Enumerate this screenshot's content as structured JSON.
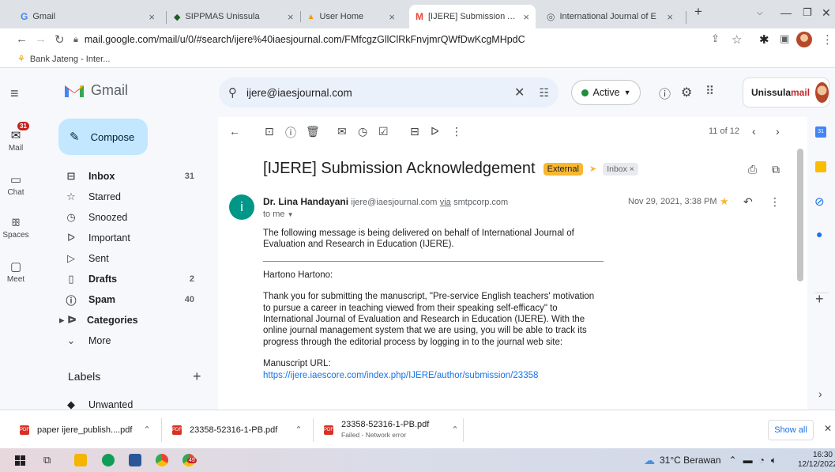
{
  "browser": {
    "tabs": [
      {
        "title": "Gmail",
        "icon": "gmail-g-icon"
      },
      {
        "title": "SIPPMAS Unissula",
        "icon": "sippmas-icon"
      },
      {
        "title": "User Home",
        "icon": "user-home-icon"
      },
      {
        "title": "[IJERE] Submission Ackno",
        "icon": "gmail-icon",
        "active": true
      },
      {
        "title": "International Journal of E",
        "icon": "globe-icon"
      }
    ],
    "new_tab": "+",
    "url": "mail.google.com/mail/u/0/#search/ijere%40iaesjournal.com/FMfcgzGllClRkFnvjmrQWfDwKcgMHpdC",
    "bookmark": "Bank Jateng - Inter..."
  },
  "gmail": {
    "brand": "Gmail",
    "search_value": "ijere@iaesjournal.com",
    "status": "Active",
    "account_label_prefix": "Unissula",
    "account_label_suffix": "mail",
    "rail": {
      "mail_badge": "31",
      "items": [
        "Mail",
        "Chat",
        "Spaces",
        "Meet"
      ]
    },
    "compose_label": "Compose",
    "nav": [
      {
        "label": "Inbox",
        "count": "31",
        "bold": true,
        "icon": "inbox-icon"
      },
      {
        "label": "Starred",
        "count": "",
        "bold": false,
        "icon": "star-icon"
      },
      {
        "label": "Snoozed",
        "count": "",
        "bold": false,
        "icon": "clock-icon"
      },
      {
        "label": "Important",
        "count": "",
        "bold": false,
        "icon": "important-icon"
      },
      {
        "label": "Sent",
        "count": "",
        "bold": false,
        "icon": "send-icon"
      },
      {
        "label": "Drafts",
        "count": "2",
        "bold": true,
        "icon": "draft-icon"
      },
      {
        "label": "Spam",
        "count": "40",
        "bold": true,
        "icon": "spam-icon"
      },
      {
        "label": "Categories",
        "count": "",
        "bold": true,
        "icon": "label-icon"
      },
      {
        "label": "More",
        "count": "",
        "bold": false,
        "icon": "chevron-down-icon"
      }
    ],
    "labels_heading": "Labels",
    "labels": [
      "Unwanted"
    ],
    "pagination": "11 of 12",
    "message": {
      "subject": "[IJERE] Submission Acknowledgement",
      "label_external": "External",
      "label_inbox": "Inbox",
      "sender_name": "Dr. Lina Handayani",
      "sender_email": "ijere@iaesjournal.com",
      "via_label": "via",
      "via_domain": "smtpcorp.com",
      "to": "to me",
      "date": "Nov 29, 2021, 3:38 PM",
      "avatar_letter": "i",
      "intro": "The following message is being delivered on behalf of International Journal of Evaluation and Research in Education (IJERE).",
      "greeting": "Hartono Hartono:",
      "body": "Thank you for submitting the manuscript, \"Pre-service English teachers' motivation to pursue a career in teaching viewed from their speaking self-efficacy\" to International Journal of Evaluation and Research in Education (IJERE). With the online journal management system that we are using, you will be able to track its progress through the editorial process by logging in to the journal web site:",
      "url_label": "Manuscript URL:",
      "url": "https://ijere.iaescore.com/index.php/IJERE/author/submission/23358"
    }
  },
  "downloads": {
    "items": [
      {
        "name": "paper ijere_publish....pdf",
        "status": ""
      },
      {
        "name": "23358-52316-1-PB.pdf",
        "status": ""
      },
      {
        "name": "23358-52316-1-PB.pdf",
        "status": "Failed - Network error"
      }
    ],
    "show_all": "Show all"
  },
  "taskbar": {
    "weather": "31°C Berawan",
    "time": "16:30",
    "date": "12/12/2022",
    "chrome_badge": "49"
  },
  "colors": {
    "gmail_bg": "#f6f8fc",
    "compose": "#c2e7ff",
    "external_label": "#f8b730",
    "link": "#1a73e8",
    "avatar": "#009688"
  }
}
